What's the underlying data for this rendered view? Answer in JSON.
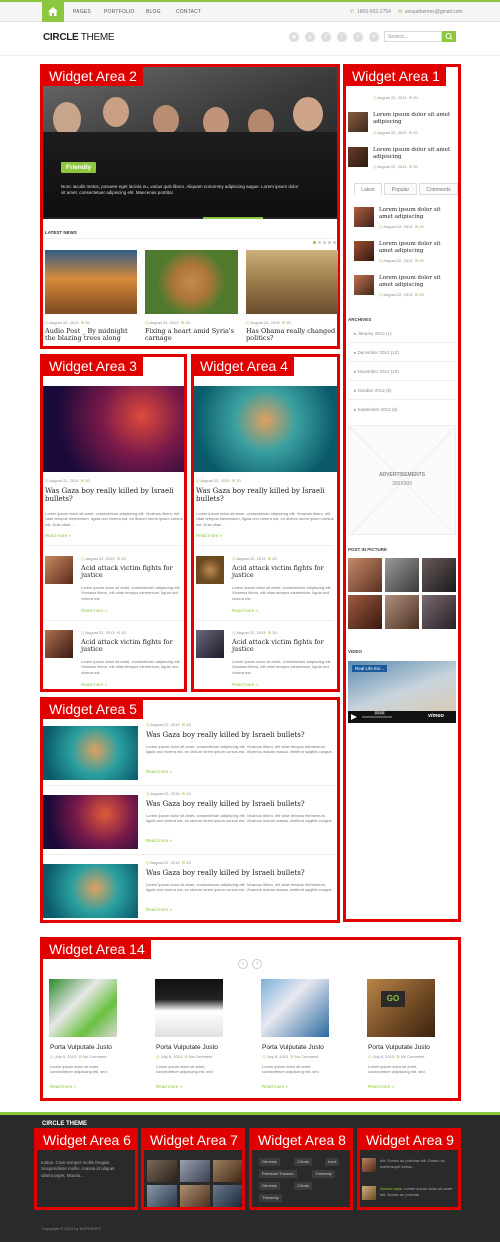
{
  "topbar": {
    "nav": [
      "PAGES",
      "PORTFOLIO",
      "BLOG",
      "CONTACT"
    ],
    "phone": "1800-562-2754",
    "email": "sospathemes@gmail.com"
  },
  "header": {
    "logo_bold": "CIRCLE",
    "logo_light": " THEME",
    "search_placeholder": "Search..."
  },
  "colors": {
    "accent": "#8dc63f",
    "label": "#e00000",
    "footer": "#2a2a2a"
  },
  "widget_labels": {
    "w1": "Widget Area 1",
    "w2": "Widget Area 2",
    "w3": "Widget Area 3",
    "w4": "Widget Area 4",
    "w5": "Widget Area 5",
    "w14": "Widget Area 14",
    "w6": "Widget Area 6",
    "w7": "Widget Area 7",
    "w8": "Widget Area 8",
    "w9": "Widget Area 9"
  },
  "slider": {
    "tag": "Friendly",
    "caption": "Nunc iaculis metus, posuere eget lacinia eu, varius quis libero. Aliquam nonummy adipiscing augue. Lorem ipsum dolor sit amet, consectetuer adipiscing elit. Maecenas porttitor."
  },
  "latest_news": {
    "heading": "LATEST NEWS",
    "items": [
      {
        "date": "August 22, 2013",
        "comments": "20",
        "title": "Audio Post _ By midnight the blazing trees along"
      },
      {
        "date": "August 22, 2013",
        "comments": "20",
        "title": "Fixing a heart amid Syria's carnage"
      },
      {
        "date": "August 22, 2013",
        "comments": "20",
        "title": "Has Obama really changed politics?"
      }
    ]
  },
  "col3": {
    "main": {
      "date": "August 22, 2013",
      "comments": "20",
      "title": "Was Gaza boy really killed by Israeli bullets?",
      "excerpt": "Lorem ipsum dolor sit amet, consectetuer adipiscing elit. Vivamus libero, elit vitae tempus elementum, ligula orci viverra est, eu dictum lorem ipsum cursus est. Duis vitae ...",
      "more": "Read more »"
    },
    "small": [
      {
        "date": "August 22, 2013",
        "comments": "20",
        "title": "Acid attack victim fights for justice",
        "excerpt": "Lorem ipsum dolor sit amet, consectetuer adipiscing elit. Vivamus libero, elit vitae tempus elementum, ligula orci viverra est.",
        "more": "Read more »"
      },
      {
        "date": "August 22, 2013",
        "comments": "20",
        "title": "Acid attack victim fights for justice",
        "excerpt": "Lorem ipsum dolor sit amet, consectetuer adipiscing elit. Vivamus libero, elit vitae tempus elementum, ligula orci viverra est.",
        "more": "Read more »"
      }
    ]
  },
  "col4": {
    "main": {
      "date": "August 22, 2013",
      "comments": "20",
      "title": "Was Gaza boy really killed by Israeli bullets?",
      "excerpt": "Lorem ipsum dolor sit amet, consectetuer adipiscing elit. Vivamus libero, elit vitae tempus elementum, ligula orci viverra est, eu dictum lorem ipsum cursus est. Duis vitae ...",
      "more": "Read more »"
    },
    "small": [
      {
        "date": "August 22, 2013",
        "comments": "20",
        "title": "Acid attack victim fights for justice",
        "excerpt": "Lorem ipsum dolor sit amet, consectetuer adipiscing elit. Vivamus libero, elit vitae tempus elementum, ligula orci viverra est.",
        "more": "Read more »"
      },
      {
        "date": "August 22, 2013",
        "comments": "20",
        "title": "Acid attack victim fights for justice",
        "excerpt": "Lorem ipsum dolor sit amet, consectetuer adipiscing elit. Vivamus libero, elit vitae tempus elementum, ligula orci viverra est.",
        "more": "Read more »"
      }
    ]
  },
  "col5": [
    {
      "date": "August 22, 2013",
      "comments": "20",
      "title": "Was Gaza boy really killed by Israeli bullets?",
      "excerpt": "Lorem ipsum dolor sit amet, consectetuer adipiscing elit. Vivamus libero, elit vitae tempus elementum, ligula orci viverra est, eu dictum lorem ipsum cursus est. Vivamus mauris massa, eleifend sagittis congue.",
      "more": "Read more »"
    },
    {
      "date": "August 22, 2013",
      "comments": "20",
      "title": "Was Gaza boy really killed by Israeli bullets?",
      "excerpt": "Lorem ipsum dolor sit amet, consectetuer adipiscing elit. Vivamus libero, elit vitae tempus elementum, ligula orci viverra est, eu dictum lorem ipsum cursus est. Vivamus mauris massa, eleifend sagittis congue.",
      "more": "Read more »"
    },
    {
      "date": "August 22, 2013",
      "comments": "20",
      "title": "Was Gaza boy really killed by Israeli bullets?",
      "excerpt": "Lorem ipsum dolor sit amet, consectetuer adipiscing elit. Vivamus libero, elit vitae tempus elementum, ligula orci viverra est, eu dictum lorem ipsum cursus est. Vivamus mauris massa, eleifend sagittis congue.",
      "more": "Read more »"
    }
  ],
  "sidebar": {
    "top_items": [
      {
        "date": "August 22, 2013",
        "comments": "20",
        "title": "Lorem ipsum dolor sit amet adipiscing"
      },
      {
        "date": "August 22, 2013",
        "comments": "20",
        "title": "Lorem ipsum dolor sit amet adipiscing"
      },
      {
        "date": "August 22, 2013",
        "comments": "20",
        "title": "Lorem ipsum dolor sit amet adipiscing"
      }
    ],
    "tabs": [
      "Latest",
      "Popular",
      "Comments"
    ],
    "tab_items": [
      {
        "date": "August 22, 2013",
        "comments": "20",
        "title": "Lorem ipsum dolor sit amet adipiscing"
      },
      {
        "date": "August 22, 2013",
        "comments": "20",
        "title": "Lorem ipsum dolor sit amet adipiscing"
      },
      {
        "date": "August 22, 2013",
        "comments": "20",
        "title": "Lorem ipsum dolor sit amet adipiscing"
      }
    ],
    "archives_heading": "ARCHIVES",
    "archives": [
      "January 2013 (1)",
      "December 2012 (12)",
      "November 2012 (10)",
      "October 2012 (9)",
      "September 2012 (5)"
    ],
    "ad_title": "ADVERTISEMENTS",
    "ad_size": "300X300",
    "pic_heading": "POST IN PICTURE",
    "video_heading": "VIDEO",
    "video_title": "Real Life Exi...",
    "video_time": "01:15",
    "video_brand": "vimeo"
  },
  "portfolio": {
    "items": [
      {
        "title": "Porta Vulputate Justo",
        "date": "July 8, 2013",
        "comments": "No Comment",
        "excerpt": "Lorem ipsum dolor sit amet, consectetuer adipiscing elit, sed",
        "more": "Read more »"
      },
      {
        "title": "Porta Vulputate Justo",
        "date": "July 8, 2013",
        "comments": "No Comment",
        "excerpt": "Lorem ipsum dolor sit amet, consectetuer adipiscing elit, sed",
        "more": "Read more »"
      },
      {
        "title": "Porta Vulputate Justo",
        "date": "July 8, 2013",
        "comments": "No Comment",
        "excerpt": "Lorem ipsum dolor sit amet, consectetuer adipiscing elit, sed",
        "more": "Read more »"
      },
      {
        "title": "Porta Vulputate Justo",
        "date": "July 8, 2013",
        "comments": "No Comment",
        "excerpt": "Lorem ipsum dolor sit amet, consectetuer adipiscing elit, sed",
        "more": "Read more »"
      }
    ],
    "go_label": "GO"
  },
  "footer": {
    "col1_heading": "CIRCLE THEME",
    "col1_text": "Iustus. Cras semper mollis feugiat. Suspendisse mollis, massa id aliquet ullamcorper, Mauris...",
    "tags": [
      "Genesis",
      "Clicufo",
      "Iconi",
      "Premium Themes",
      "Themedy",
      "Genesis",
      "Clicufo",
      "Themedy"
    ],
    "col4_text": "elit. Donec ac pulvinar elit. Donec ac scelerisque luctus...",
    "col4_author": "Davind says:",
    "col4_comment": "Lorem ipsum dolor sit amet elit. Donec ac pulvinar",
    "copyright": "Copyright © 2013 by KOPASOFT"
  }
}
